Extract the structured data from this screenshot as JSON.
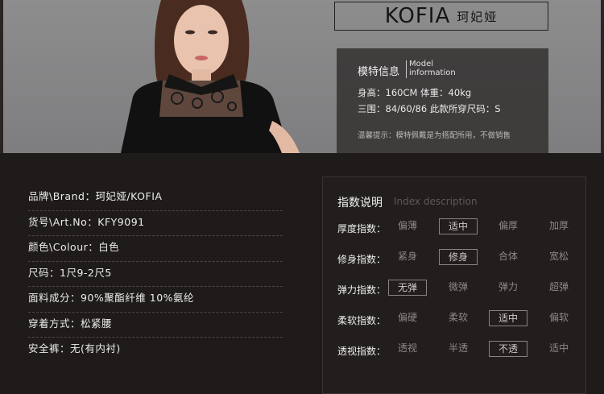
{
  "brand": {
    "en": "KOFIA",
    "cn": "珂妃娅"
  },
  "model_info": {
    "title": "模特信息",
    "subtitle_line1": "Model",
    "subtitle_line2": "information",
    "line1": "身高：160CM  体重：40kg",
    "line2": "三围：84/60/86   此款所穿尺码：S",
    "note": "温馨提示：模特佩戴是为搭配所用，不做销售"
  },
  "specs": [
    "品牌\\Brand：珂妃娅/KOFIA",
    "货号\\Art.No：KFY9091",
    "颜色\\Colour：白色",
    "尺码：1尺9-2尺5",
    "面料成分：90%聚酯纤维   10%氨纶",
    "穿着方式：松紧腰",
    "安全裤：无(有内衬)"
  ],
  "index": {
    "title": "指数说明",
    "subtitle": "Index description",
    "rows": [
      {
        "label": "厚度指数：",
        "options": [
          "偏薄",
          "适中",
          "偏厚",
          "加厚"
        ],
        "selected": 1
      },
      {
        "label": "修身指数：",
        "options": [
          "紧身",
          "修身",
          "合体",
          "宽松"
        ],
        "selected": 1
      },
      {
        "label": "弹力指数：",
        "options": [
          "无弹",
          "微弹",
          "弹力",
          "超弹"
        ],
        "selected": 0
      },
      {
        "label": "柔软指数：",
        "options": [
          "偏硬",
          "柔软",
          "适中",
          "偏软"
        ],
        "selected": 2
      },
      {
        "label": "透视指数：",
        "options": [
          "透视",
          "半透",
          "不透",
          "适中"
        ],
        "selected": 2
      }
    ]
  },
  "colors": {
    "page_bg": "#1f1b1a",
    "hero_bg": "#858587",
    "panel_bg": "#3a3736"
  }
}
